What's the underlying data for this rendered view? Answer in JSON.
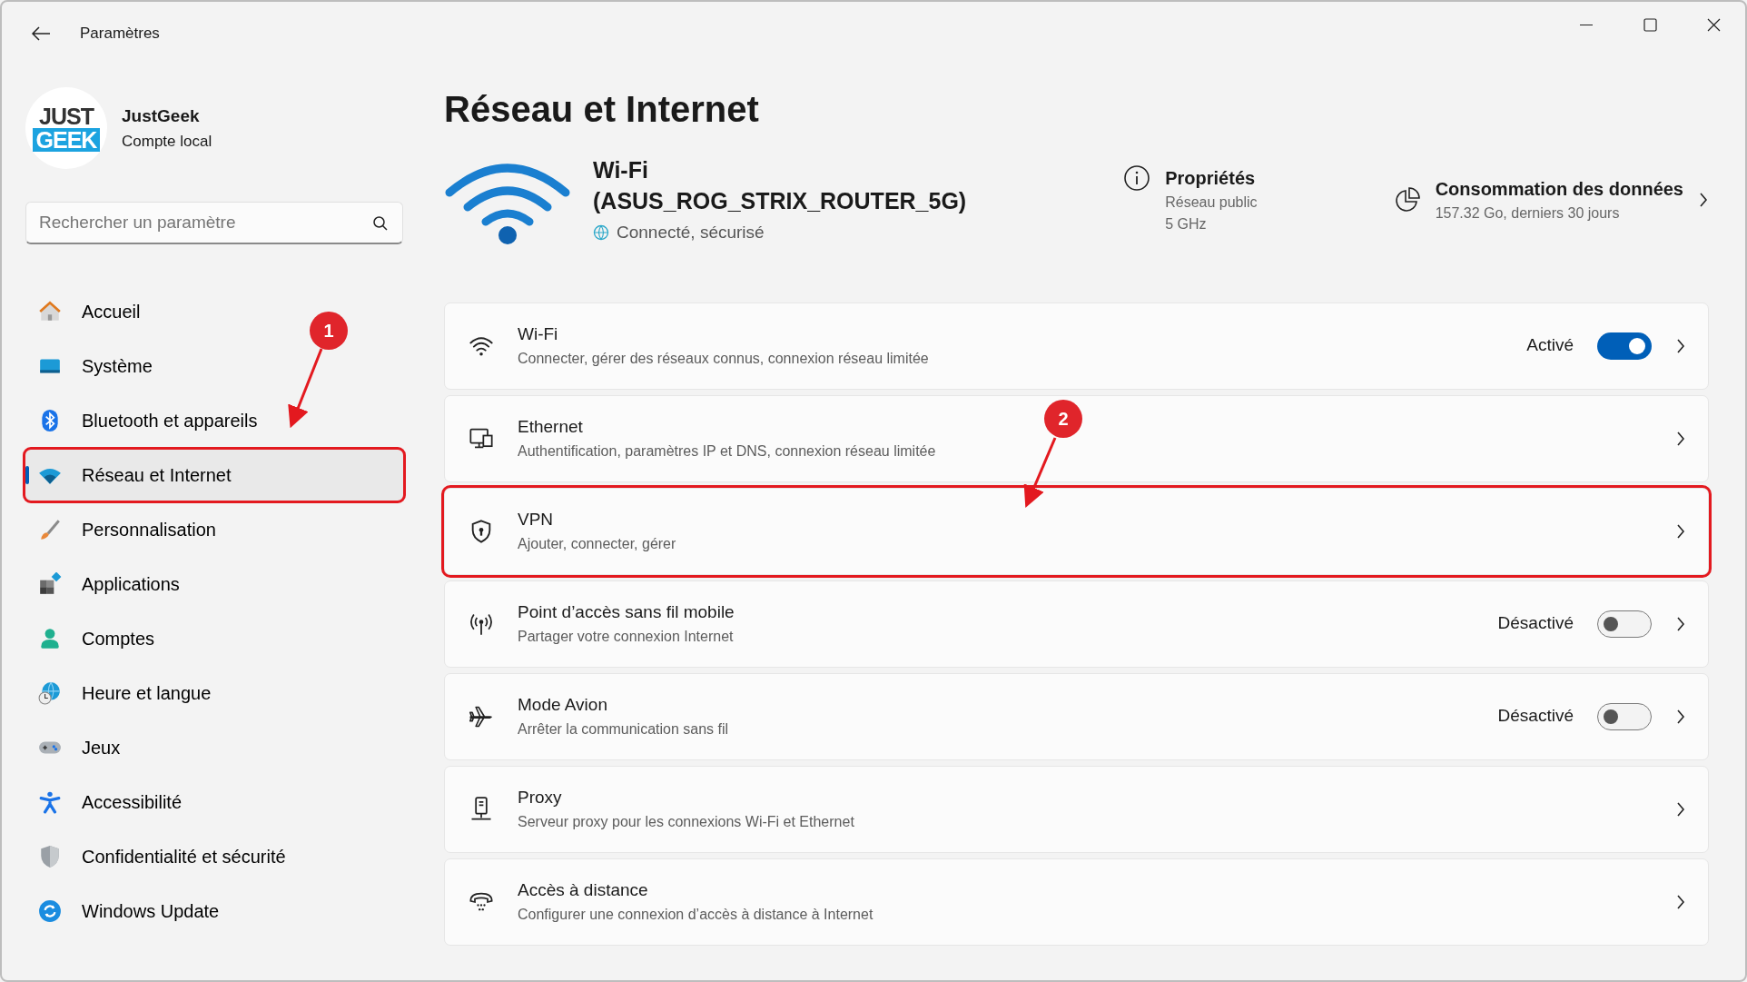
{
  "window": {
    "title": "Paramètres"
  },
  "profile": {
    "logo_lines": [
      "JUST",
      "GEEK"
    ],
    "name": "JustGeek",
    "account": "Compte local"
  },
  "search": {
    "placeholder": "Rechercher un paramètre"
  },
  "sidebar": {
    "items": [
      {
        "label": "Accueil",
        "selected": false,
        "highlighted": false
      },
      {
        "label": "Système",
        "selected": false,
        "highlighted": false
      },
      {
        "label": "Bluetooth et appareils",
        "selected": false,
        "highlighted": false
      },
      {
        "label": "Réseau et Internet",
        "selected": true,
        "highlighted": true
      },
      {
        "label": "Personnalisation",
        "selected": false,
        "highlighted": false
      },
      {
        "label": "Applications",
        "selected": false,
        "highlighted": false
      },
      {
        "label": "Comptes",
        "selected": false,
        "highlighted": false
      },
      {
        "label": "Heure et langue",
        "selected": false,
        "highlighted": false
      },
      {
        "label": "Jeux",
        "selected": false,
        "highlighted": false
      },
      {
        "label": "Accessibilité",
        "selected": false,
        "highlighted": false
      },
      {
        "label": "Confidentialité et sécurité",
        "selected": false,
        "highlighted": false
      },
      {
        "label": "Windows Update",
        "selected": false,
        "highlighted": false
      }
    ]
  },
  "page_title": "Réseau et Internet",
  "connection": {
    "name": "Wi-Fi",
    "ssid": "(ASUS_ROG_STRIX_ROUTER_5G)",
    "status": "Connecté, sécurisé",
    "properties": {
      "title": "Propriétés",
      "lines": [
        "Réseau public",
        "5 GHz"
      ]
    },
    "usage": {
      "title": "Consommation des données",
      "detail": "157.32 Go, derniers 30 jours"
    }
  },
  "settings": [
    {
      "kind": "toggle",
      "title": "Wi-Fi",
      "subtitle": "Connecter, gérer des réseaux connus, connexion réseau limitée",
      "state_label": "Activé",
      "on": true,
      "highlighted": false
    },
    {
      "kind": "link",
      "title": "Ethernet",
      "subtitle": "Authentification, paramètres IP et DNS, connexion réseau limitée",
      "highlighted": false
    },
    {
      "kind": "link",
      "title": "VPN",
      "subtitle": "Ajouter, connecter, gérer",
      "highlighted": true
    },
    {
      "kind": "toggle",
      "title": "Point d’accès sans fil mobile",
      "subtitle": "Partager votre connexion Internet",
      "state_label": "Désactivé",
      "on": false,
      "highlighted": false
    },
    {
      "kind": "toggle",
      "title": "Mode Avion",
      "subtitle": "Arrêter la communication sans fil",
      "state_label": "Désactivé",
      "on": false,
      "highlighted": false
    },
    {
      "kind": "link",
      "title": "Proxy",
      "subtitle": "Serveur proxy pour les connexions Wi-Fi et Ethernet",
      "highlighted": false
    },
    {
      "kind": "link",
      "title": "Accès à distance",
      "subtitle": "Configurer une connexion d’accès à distance à Internet",
      "highlighted": false
    }
  ],
  "annotations": [
    {
      "label": "1"
    },
    {
      "label": "2"
    }
  ]
}
